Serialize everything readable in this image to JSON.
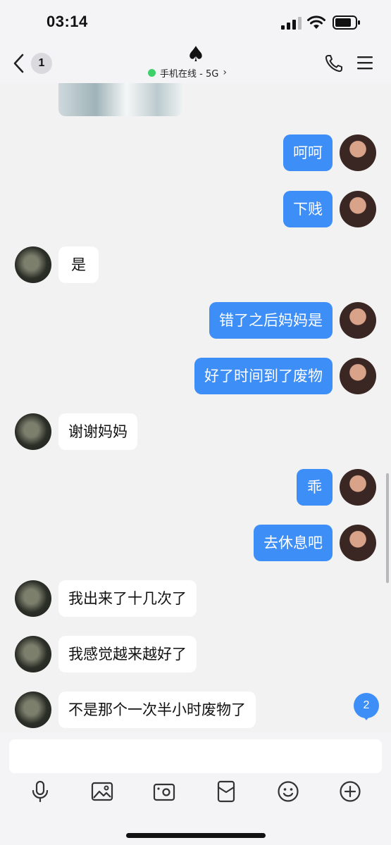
{
  "status": {
    "time": "03:14"
  },
  "header": {
    "unread_count": "1",
    "title_symbol": "♠",
    "online_status": "手机在线 - 5G"
  },
  "messages": [
    {
      "from": "me",
      "text": "呵呵"
    },
    {
      "from": "me",
      "text": "下贱"
    },
    {
      "from": "them",
      "text": "是"
    },
    {
      "from": "me",
      "text": "错了之后妈妈是"
    },
    {
      "from": "me",
      "text": "好了时间到了废物"
    },
    {
      "from": "them",
      "text": "谢谢妈妈"
    },
    {
      "from": "me",
      "text": "乖"
    },
    {
      "from": "me",
      "text": "去休息吧"
    },
    {
      "from": "them",
      "text": "我出来了十几次了"
    },
    {
      "from": "them",
      "text": "我感觉越来越好了"
    },
    {
      "from": "them",
      "text": "不是那个一次半小时废物了"
    }
  ],
  "new_message_badge": "2",
  "input": {
    "value": "",
    "placeholder": ""
  },
  "toolbar": [
    "microphone-icon",
    "image-icon",
    "camera-icon",
    "red-packet-icon",
    "emoji-icon",
    "plus-icon"
  ],
  "colors": {
    "my_bubble": "#3e8ef7",
    "their_bubble": "#ffffff",
    "online_dot": "#3ed06a",
    "background": "#f2f2f2"
  }
}
